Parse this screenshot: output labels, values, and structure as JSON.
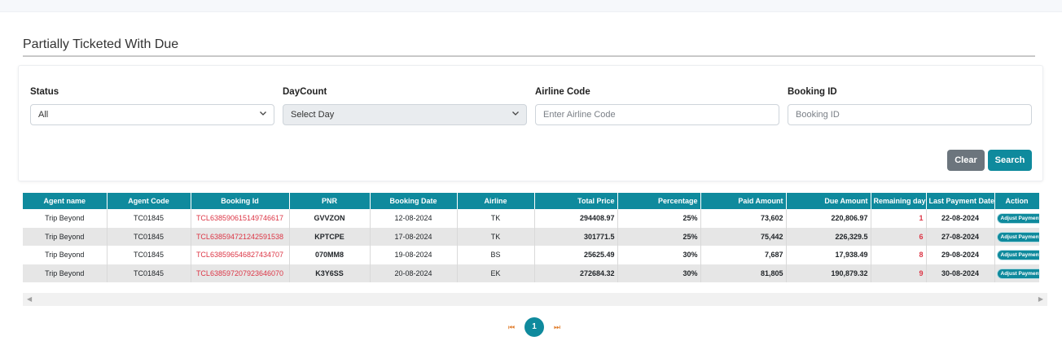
{
  "page": {
    "title": "Partially Ticketed With Due"
  },
  "filters": {
    "status": {
      "label": "Status",
      "value": "All"
    },
    "day_count": {
      "label": "DayCount",
      "value": "Select Day"
    },
    "airline_code": {
      "label": "Airline Code",
      "placeholder": "Enter Airline Code"
    },
    "booking_id": {
      "label": "Booking ID",
      "placeholder": "Booking ID"
    },
    "clear_label": "Clear",
    "search_label": "Search"
  },
  "table": {
    "headers": [
      "Agent name",
      "Agent Code",
      "Booking Id",
      "PNR",
      "Booking Date",
      "Airline",
      "Total Price",
      "Percentage",
      "Paid Amount",
      "Due Amount",
      "Remaining day",
      "Last Payment Date",
      "Action"
    ],
    "rows": [
      {
        "agent_name": "Trip Beyond",
        "agent_code": "TC01845",
        "booking_id": "TCL638590615149746617",
        "pnr": "GVVZON",
        "booking_date": "12-08-2024",
        "airline": "TK",
        "total_price": "294408.97",
        "percentage": "25%",
        "paid_amount": "73,602",
        "due_amount": "220,806.97",
        "remaining_day": "1",
        "last_payment_date": "22-08-2024",
        "action": "Adjust Payment"
      },
      {
        "agent_name": "Trip Beyond",
        "agent_code": "TC01845",
        "booking_id": "TCL638594721242591538",
        "pnr": "KPTCPE",
        "booking_date": "17-08-2024",
        "airline": "TK",
        "total_price": "301771.5",
        "percentage": "25%",
        "paid_amount": "75,442",
        "due_amount": "226,329.5",
        "remaining_day": "6",
        "last_payment_date": "27-08-2024",
        "action": "Adjust Payment"
      },
      {
        "agent_name": "Trip Beyond",
        "agent_code": "TC01845",
        "booking_id": "TCL638596546827434707",
        "pnr": "070MM8",
        "booking_date": "19-08-2024",
        "airline": "BS",
        "total_price": "25625.49",
        "percentage": "30%",
        "paid_amount": "7,687",
        "due_amount": "17,938.49",
        "remaining_day": "8",
        "last_payment_date": "29-08-2024",
        "action": "Adjust Payment"
      },
      {
        "agent_name": "Trip Beyond",
        "agent_code": "TC01845",
        "booking_id": "TCL638597207923646070",
        "pnr": "K3Y6SS",
        "booking_date": "20-08-2024",
        "airline": "EK",
        "total_price": "272684.32",
        "percentage": "30%",
        "paid_amount": "81,805",
        "due_amount": "190,879.32",
        "remaining_day": "9",
        "last_payment_date": "30-08-2024",
        "action": "Adjust Payment"
      }
    ]
  },
  "pagination": {
    "current": "1",
    "first_icon": "first-page-icon",
    "last_icon": "last-page-icon"
  },
  "colors": {
    "accent": "#0f8a9d",
    "danger": "#dc3545",
    "clear_button": "#6c757d"
  }
}
